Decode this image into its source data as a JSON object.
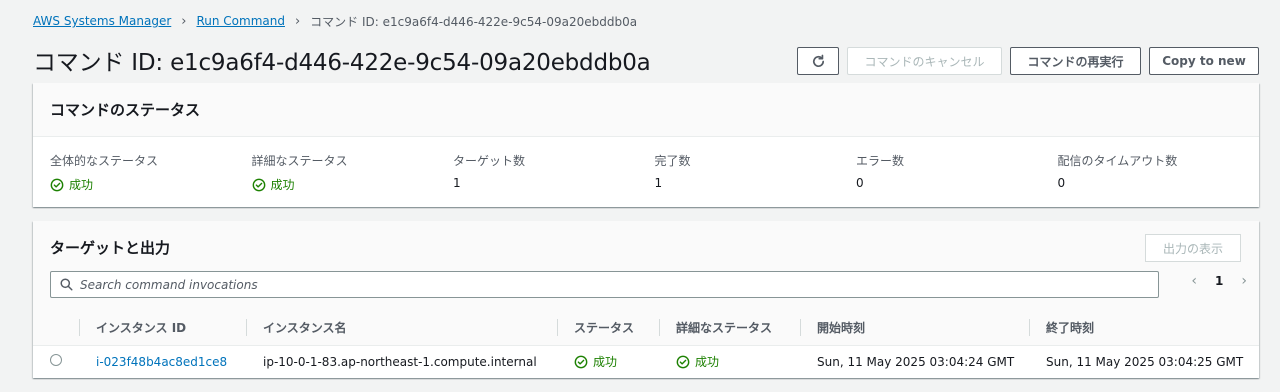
{
  "breadcrumb": {
    "items": [
      "AWS Systems Manager",
      "Run Command"
    ],
    "current": "コマンド ID: e1c9a6f4-d446-422e-9c54-09a20ebddb0a"
  },
  "page_title": "コマンド ID: e1c9a6f4-d446-422e-9c54-09a20ebddb0a",
  "actions": {
    "refresh_icon": "refresh-icon",
    "cancel_label": "コマンドのキャンセル",
    "rerun_label": "コマンドの再実行",
    "copy_label": "Copy to new"
  },
  "status_panel": {
    "title": "コマンドのステータス",
    "fields": [
      {
        "label": "全体的なステータス",
        "value": "成功"
      },
      {
        "label": "詳細なステータス",
        "value": "成功"
      },
      {
        "label": "ターゲット数",
        "value": "1"
      },
      {
        "label": "完了数",
        "value": "1"
      },
      {
        "label": "エラー数",
        "value": "0"
      },
      {
        "label": "配信のタイムアウト数",
        "value": "0"
      }
    ]
  },
  "targets_panel": {
    "title": "ターゲットと出力",
    "output_button": "出力の表示",
    "search_placeholder": "Search command invocations",
    "page": "1",
    "columns": [
      "インスタンス ID",
      "インスタンス名",
      "ステータス",
      "詳細なステータス",
      "開始時刻",
      "終了時刻"
    ],
    "rows": [
      {
        "instance_id": "i-023f48b4ac8ed1ce8",
        "instance_name": "ip-10-0-1-83.ap-northeast-1.compute.internal",
        "status": "成功",
        "detailed_status": "成功",
        "start_time": "Sun, 11 May 2025 03:04:24 GMT",
        "end_time": "Sun, 11 May 2025 03:04:25 GMT"
      }
    ]
  },
  "colors": {
    "link": "#0073bb",
    "success": "#1d8102",
    "background": "#f2f3f3"
  }
}
